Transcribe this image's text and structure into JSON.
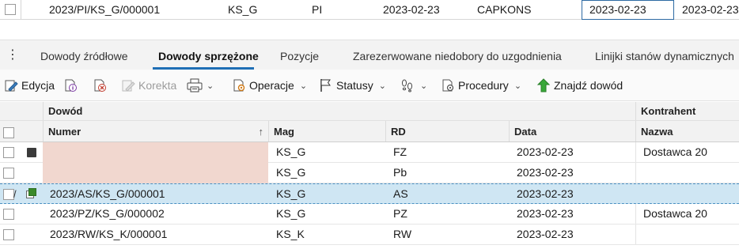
{
  "top_record": {
    "numer": "2023/PI/KS_G/000001",
    "mag": "KS_G",
    "rd": "PI",
    "data": "2023-02-23",
    "kontrahent": "CAPKONS",
    "data_edit": "2023-02-23",
    "data2": "2023-02-23"
  },
  "tabs": {
    "items": [
      {
        "label": "Dowody źródłowe"
      },
      {
        "label": "Dowody sprzężone"
      },
      {
        "label": "Pozycje"
      },
      {
        "label": "Zarezerwowane niedobory do uzgodnienia"
      },
      {
        "label": "Linijki stanów dynamicznych"
      }
    ],
    "active_index": 1
  },
  "toolbar": {
    "edycja": "Edycja",
    "korekta": "Korekta",
    "operacje": "Operacje",
    "statusy": "Statusy",
    "procedury": "Procedury",
    "znajdz": "Znajdź dowód"
  },
  "grid": {
    "group_headers": {
      "dowod": "Dowód",
      "kontrahent": "Kontrahent"
    },
    "columns": {
      "numer": "Numer",
      "mag": "Mag",
      "rd": "RD",
      "data": "Data",
      "nazwa": "Nazwa"
    },
    "rows": [
      {
        "numer": "",
        "mag": "KS_G",
        "rd": "FZ",
        "data": "2023-02-23",
        "nazwa": "Dostawca 20"
      },
      {
        "numer": "",
        "mag": "KS_G",
        "rd": "Pb",
        "data": "2023-02-23",
        "nazwa": ""
      },
      {
        "numer": "2023/AS/KS_G/000001",
        "mag": "KS_G",
        "rd": "AS",
        "data": "2023-02-23",
        "nazwa": ""
      },
      {
        "numer": "2023/PZ/KS_G/000002",
        "mag": "KS_G",
        "rd": "PZ",
        "data": "2023-02-23",
        "nazwa": "Dostawca 20"
      },
      {
        "numer": "2023/RW/KS_K/000001",
        "mag": "KS_K",
        "rd": "RW",
        "data": "2023-02-23",
        "nazwa": ""
      }
    ]
  },
  "colors": {
    "accent": "#1f6fb5",
    "selected_row": "#cfe6f3",
    "pink_cell": "#f1d7cf",
    "find_icon": "#3aa83a"
  }
}
